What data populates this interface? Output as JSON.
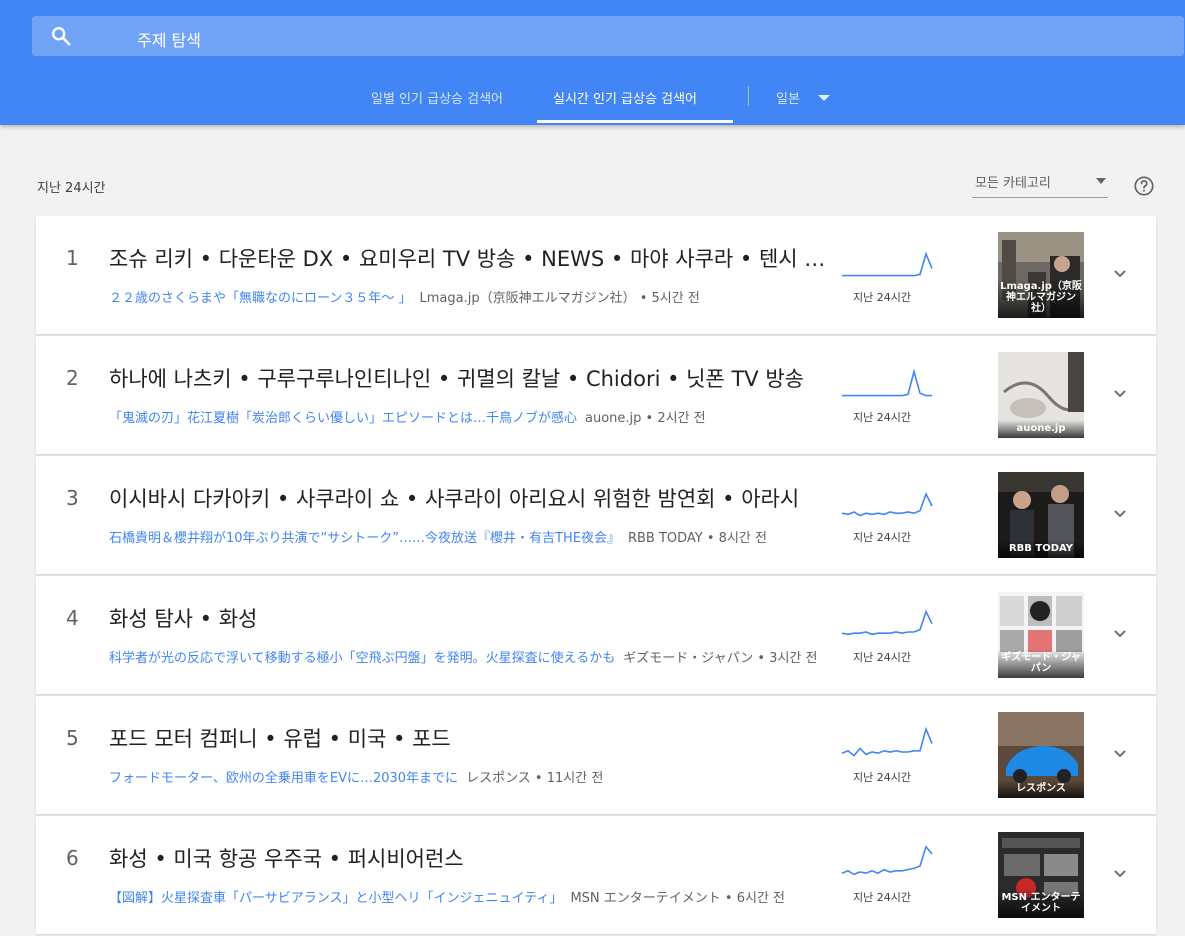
{
  "search": {
    "placeholder": "주제 탐색",
    "icon": "search-icon"
  },
  "tabs": [
    {
      "label": "일별 인기 급상승 검색어",
      "active": false
    },
    {
      "label": "실시간 인기 급상승 검색어",
      "active": true
    }
  ],
  "country": {
    "label": "일본"
  },
  "subheading": "지난 24시간",
  "category": {
    "selected": "모든 카테고리"
  },
  "spark_label": "지난 24시간",
  "colors": {
    "header": "#4285f4",
    "link": "#4285f4",
    "spark": "#4285f4"
  },
  "trends": [
    {
      "rank": "1",
      "title": "조슈 리키 • 다운타운 DX • 요미우리 TV 방송 • NEWS • 마야 사쿠라 • 텐시 히로코",
      "article": "２２歳のさくらまや「無職なのにローン３５年〜 」",
      "source": "Lmaga.jp（京阪神エルマガジン社） • 5시간 전",
      "thumb_caption": "Lmaga.jp（京阪神エルマガジン社）",
      "spark": [
        2,
        2,
        2,
        2,
        2,
        2,
        2,
        2,
        2,
        2,
        2,
        2,
        2,
        3,
        20,
        8
      ]
    },
    {
      "rank": "2",
      "title": "하나에 나츠키 • 구루구루나인티나인 • 귀멸의 칼날 • Chidori • 닛폰 TV 방송",
      "article": "「鬼滅の刃」花江夏樹「炭治郎くらい優しい」エピソードとは…千鳥ノブが感心",
      "source": "auone.jp • 2시간 전",
      "thumb_caption": "auone.jp",
      "spark": [
        2,
        2,
        2,
        2,
        2,
        2,
        2,
        2,
        2,
        2,
        2,
        3,
        22,
        4,
        2,
        2
      ]
    },
    {
      "rank": "3",
      "title": "이시바시 다카아키 • 사쿠라이 쇼 • 사쿠라이 아리요시 위험한 밤연회 • 아라시",
      "article": "石橋貴明＆櫻井翔が10年ぶり共演で“サシトーク”……今夜放送『櫻井・有吉THE夜会』",
      "source": "RBB TODAY • 8시간 전",
      "thumb_caption": "RBB TODAY",
      "spark": [
        4,
        3,
        5,
        2,
        4,
        3,
        4,
        3,
        5,
        4,
        4,
        5,
        4,
        6,
        20,
        10
      ]
    },
    {
      "rank": "4",
      "title": "화성 탐사 • 화성",
      "article": "科学者が光の反応で浮いて移動する極小「空飛ぶ円盤」を発明。火星探査に使えるかも",
      "source": "ギズモード・ジャパン • 3시간 전",
      "thumb_caption": "ギズモード・ジャパン",
      "spark": [
        4,
        3,
        4,
        4,
        5,
        3,
        4,
        4,
        4,
        5,
        4,
        5,
        5,
        7,
        22,
        12
      ]
    },
    {
      "rank": "5",
      "title": "포드 모터 컴퍼니 • 유럽 • 미국 • 포드",
      "article": "フォードモーター、欧州の全乗用車をEVに…2030年までに",
      "source": "レスポンス • 11시간 전",
      "thumb_caption": "レスポンス",
      "spark": [
        4,
        6,
        2,
        8,
        3,
        5,
        4,
        6,
        5,
        6,
        5,
        5,
        6,
        6,
        24,
        12
      ]
    },
    {
      "rank": "6",
      "title": "화성 • 미국 항공 우주국 • 퍼시비어런스",
      "article": "【図解】火星探査車「パーサビアランス」と小型ヘリ「インジェニュイティ」",
      "source": "MSN エンターテイメント • 6시간 전",
      "thumb_caption": "MSN エンターテイメント",
      "spark": [
        4,
        6,
        3,
        5,
        4,
        6,
        4,
        7,
        5,
        6,
        6,
        7,
        8,
        10,
        26,
        20
      ]
    }
  ]
}
